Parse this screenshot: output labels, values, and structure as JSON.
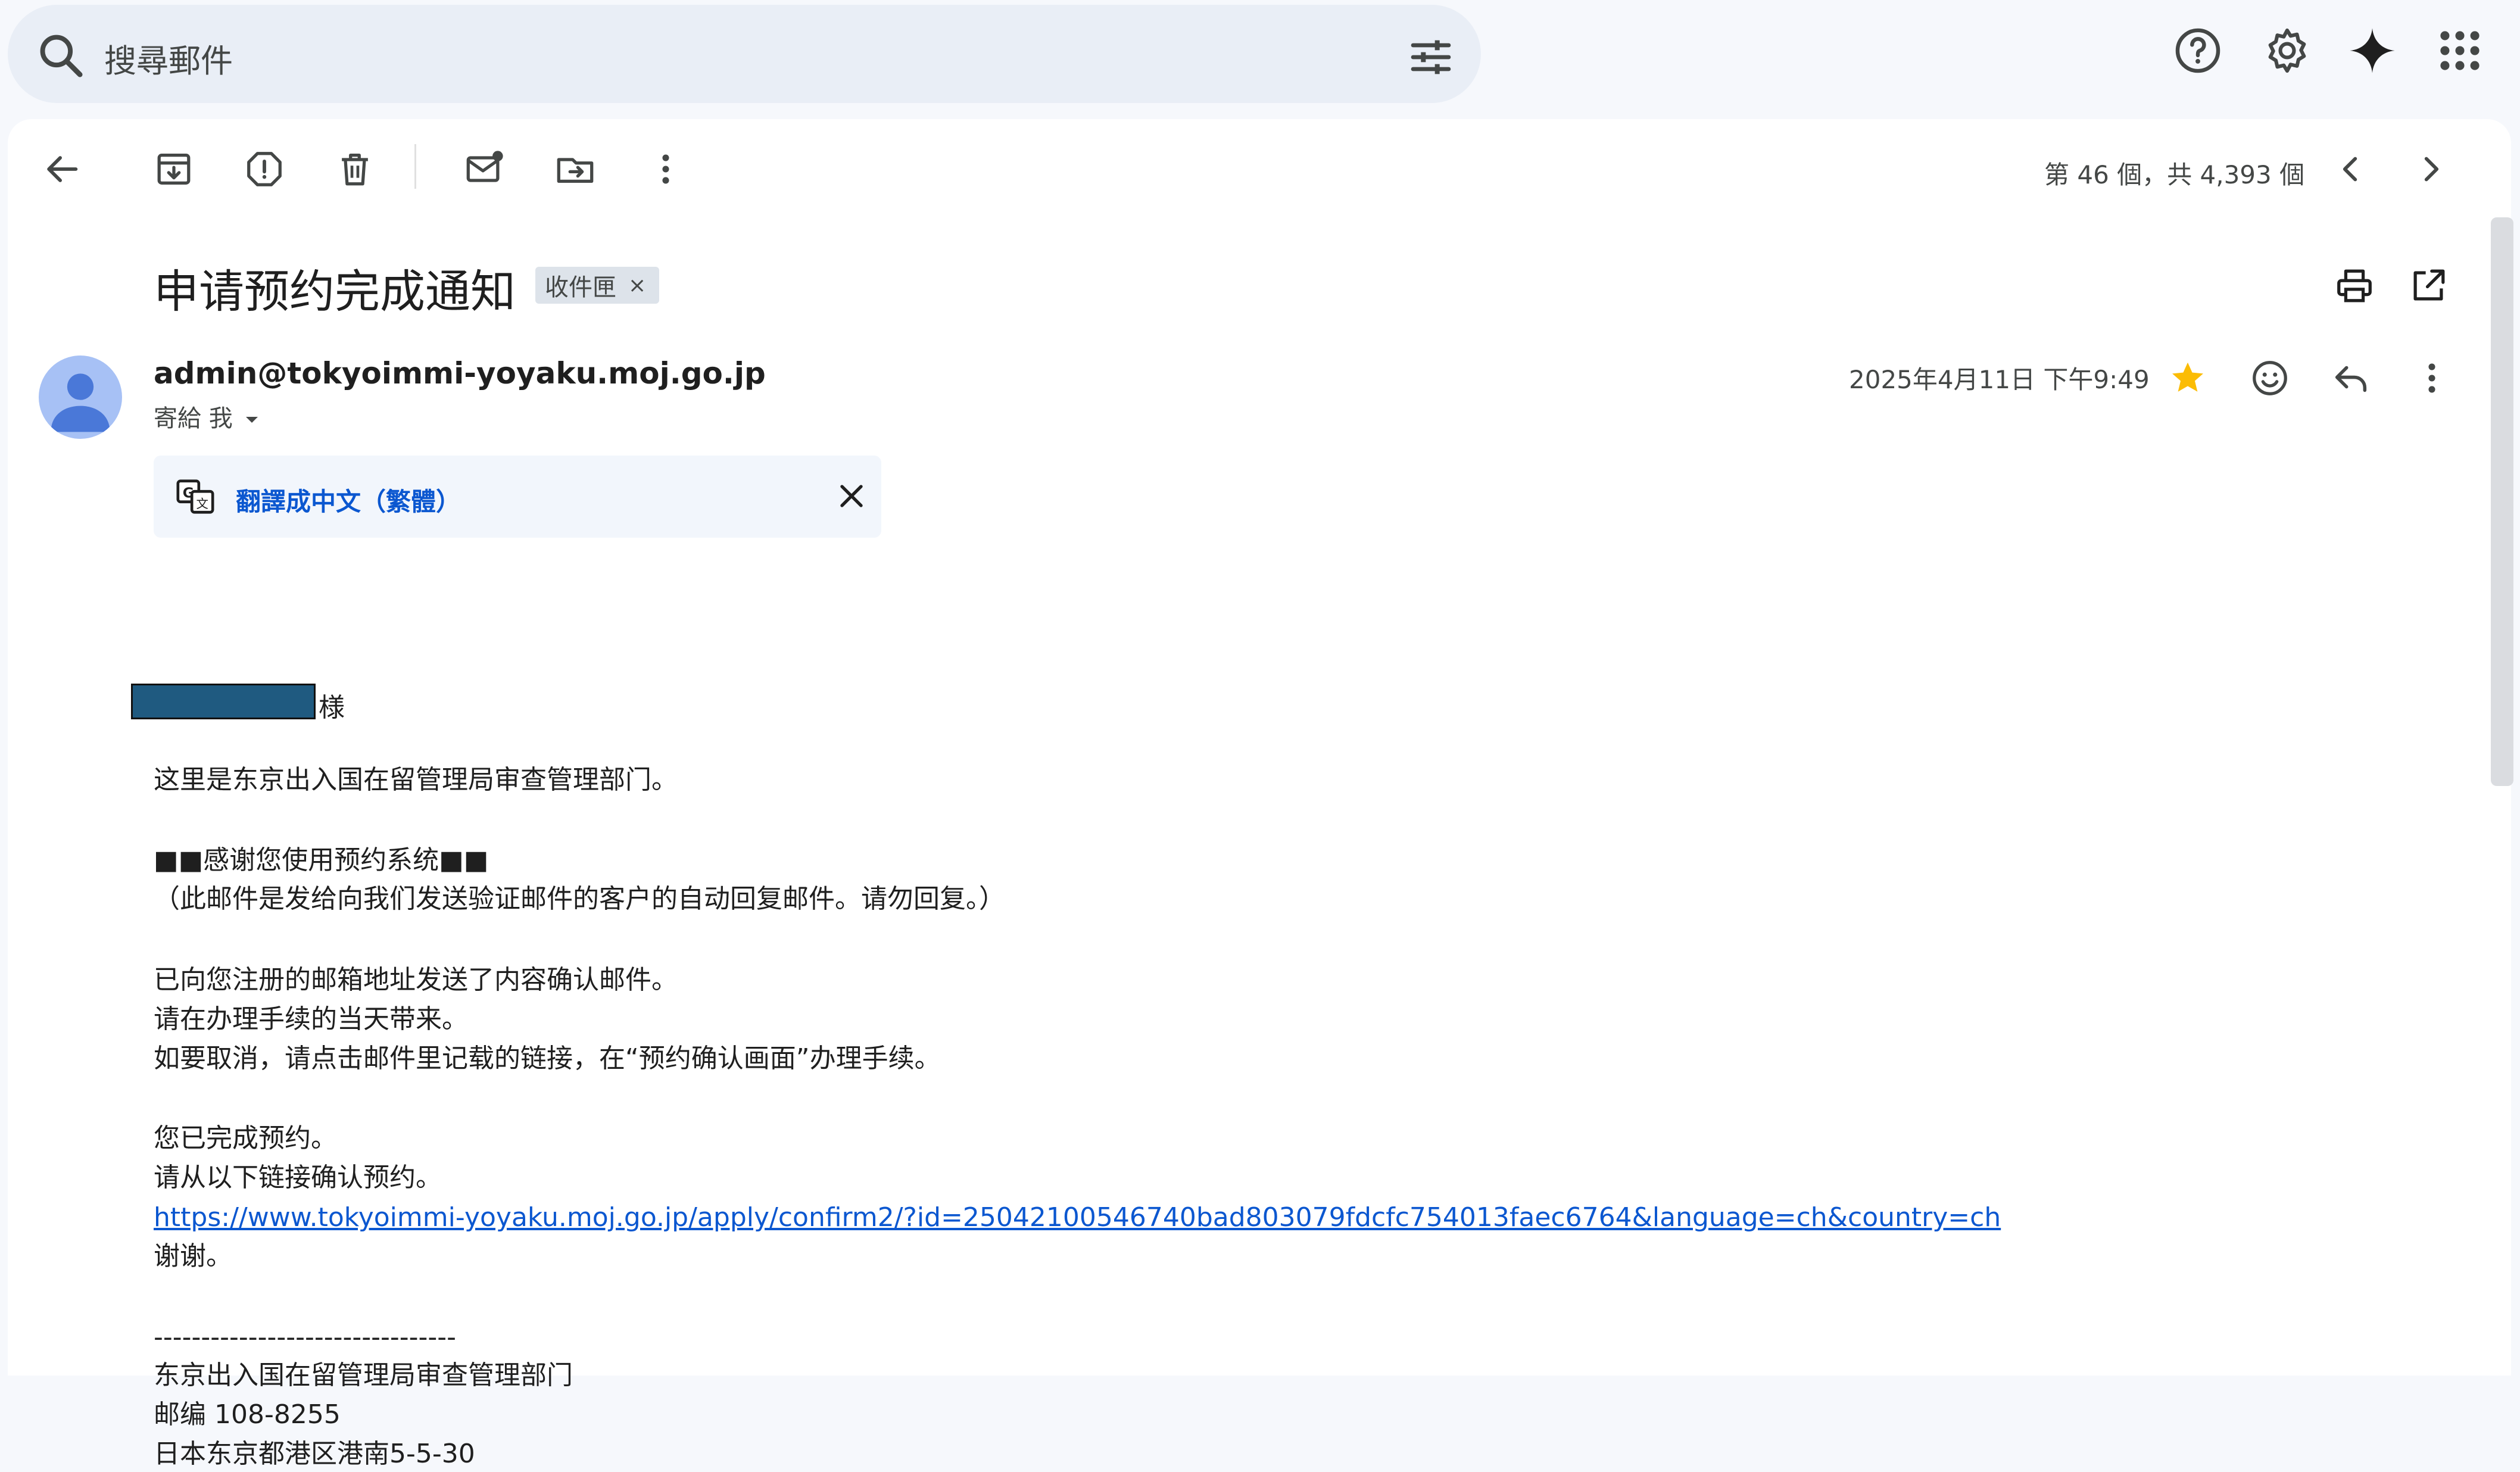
{
  "search": {
    "placeholder": "搜尋郵件"
  },
  "toolbar": {
    "page_count": "第 46 個，共 4,393 個"
  },
  "email": {
    "subject": "申请预约完成通知",
    "label": "收件匣",
    "label_close": "×",
    "sender": "admin@tokyoimmi-yoyaku.moj.go.jp",
    "to_me": "寄給 我",
    "date": "2025年4月11日 下午9:49",
    "translate_text": "翻譯成中文（繁體）",
    "honorific": "様",
    "body": {
      "line1": "这里是东京出入国在留管理局审查管理部门。",
      "line2": "■■感谢您使用预约系统■■",
      "line3": "（此邮件是发给向我们发送验证邮件的客户的自动回复邮件。请勿回复。）",
      "line4": "已向您注册的邮箱地址发送了内容确认邮件。",
      "line5": "请在办理手续的当天带来。",
      "line6": "如要取消，请点击邮件里记载的链接，在“预约确认画面”办理手续。",
      "line7": "您已完成预约。",
      "line8": "请从以下链接确认预约。",
      "link": "https://www.tokyoimmi-yoyaku.moj.go.jp/apply/confirm2/?id=25042100546740bad803079fdcfc754013faec6764&language=ch&country=ch",
      "line9": "谢谢。",
      "divider": "--------------------------------",
      "sig1": "东京出入国在留管理局审查管理部门",
      "sig2": "邮编 108-8255",
      "sig3": "日本东京都港区港南5-5-30"
    }
  },
  "colors": {
    "accent": "#0b57d0",
    "star": "#fbbc04",
    "avatar": "#a7c1f5",
    "avatar_fg": "#4a78d8"
  }
}
